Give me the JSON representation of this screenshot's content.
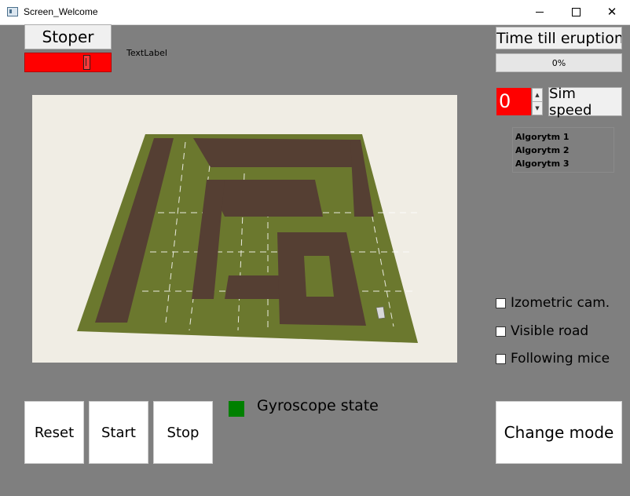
{
  "window": {
    "title": "Screen_Welcome",
    "minimize_glyph": "",
    "maximize_glyph": "",
    "close_glyph": "✕"
  },
  "stoper": {
    "button_label": "Stoper",
    "bar_color": "#ff0000"
  },
  "text_label": "TextLabel",
  "eruption": {
    "button_label": "Time till eruption",
    "progress_text": "0%",
    "progress_value": 0
  },
  "sim_speed": {
    "value": "0",
    "button_label": "Sim speed",
    "up_glyph": "▲",
    "down_glyph": "▼",
    "box_color": "#ff0000"
  },
  "algorithms": {
    "items": [
      "Algorytm 1",
      "Algorytm 2",
      "Algorytm 3"
    ]
  },
  "options": {
    "isometric_label": "Izometric cam.",
    "visible_road_label": "Visible road",
    "following_mice_label": "Following mice",
    "isometric_checked": false,
    "visible_road_checked": false,
    "following_mice_checked": false
  },
  "scene": {
    "floor_color": "#6b782e",
    "wall_color": "#553f33",
    "background_color": "#f0ede4"
  },
  "controls": {
    "reset_label": "Reset",
    "start_label": "Start",
    "stop_label": "Stop",
    "change_mode_label": "Change mode"
  },
  "gyroscope": {
    "label": "Gyroscope state",
    "state_color": "#008000"
  }
}
